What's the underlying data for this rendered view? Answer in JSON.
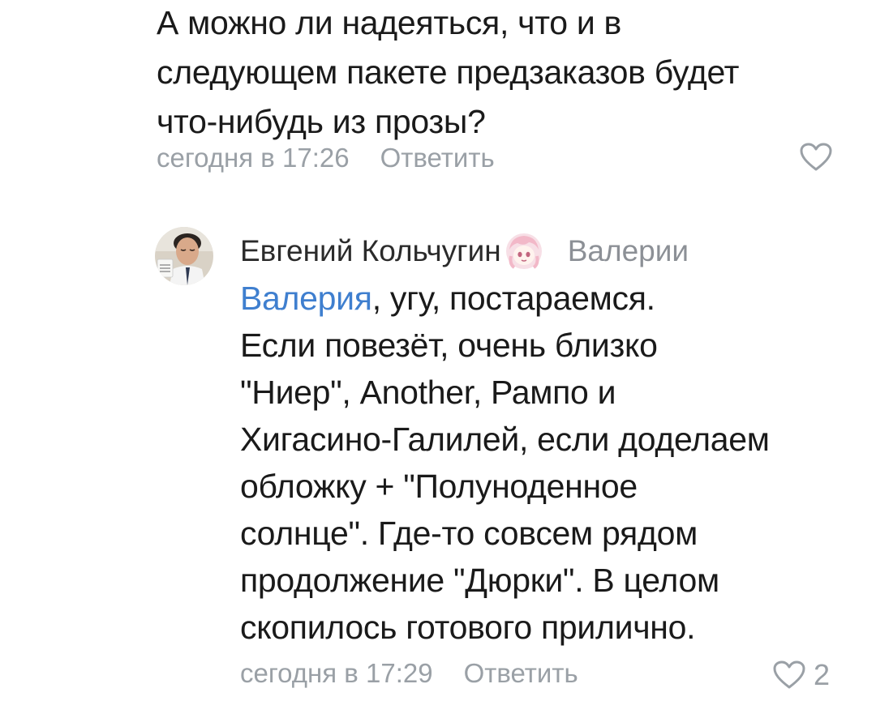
{
  "comment_prev": {
    "lines": [
      "А можно ли надеяться, что и в",
      "следующем пакете предзаказов будет",
      "что-нибудь из прозы?"
    ],
    "time": "сегодня в 17:26",
    "reply_label": "Ответить"
  },
  "comment_reply": {
    "author": "Евгений Кольчугин",
    "reply_to_first": "Валерии",
    "mention": "Валерия",
    "first_line_rest": ", угу, постараемся.",
    "lines": [
      "Если повезёт, очень близко",
      "\"Ниер\", Another, Рампо и",
      "Хигасино-Галилей, если доделаем",
      "обложку + \"Полуноденное",
      "солнце\". Где-то совсем рядом",
      "продолжение \"Дюрки\". В целом",
      "скопилось готового прилично."
    ],
    "time": "сегодня в 17:29",
    "reply_label": "Ответить",
    "likes": "2"
  },
  "colors": {
    "text": "#1a1a1a",
    "meta": "#9aa0a6",
    "mention": "#3f7fcf"
  },
  "icons": {
    "like": "heart-outline-icon",
    "badge": "anime-avatar-badge-icon"
  }
}
